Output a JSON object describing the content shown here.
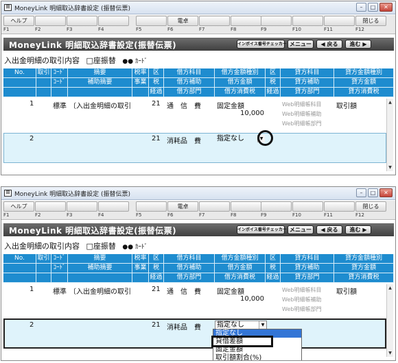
{
  "window": {
    "title": "MoneyLink 明細取込辞書設定 (振替伝票)",
    "buttons": {
      "minimize": "–",
      "maximize": "□",
      "close": "✕"
    }
  },
  "fkeys": [
    {
      "label": "ヘルプ",
      "num": "F1"
    },
    {
      "label": "",
      "num": "F2"
    },
    {
      "label": "",
      "num": "F3"
    },
    {
      "label": "",
      "num": "F4"
    },
    {
      "label": "",
      "num": "F5"
    },
    {
      "label": "電卓",
      "num": "F6"
    },
    {
      "label": "",
      "num": "F7"
    },
    {
      "label": "",
      "num": "F8"
    },
    {
      "label": "",
      "num": "F9"
    },
    {
      "label": "",
      "num": "F10"
    },
    {
      "label": "",
      "num": "F11"
    },
    {
      "label": "閉じる",
      "num": "F12"
    }
  ],
  "header": {
    "title": "MoneyLink 明細取込辞書設定(振替伝票)",
    "invoice_btn": "インボイス番号チェッカー",
    "menu_btn": "メニュー",
    "back_btn": "◀ 戻る",
    "next_btn": "進む ▶"
  },
  "subline": {
    "label": "入出金明細の取引内容",
    "check": "□座振替",
    "card": "●● ｶｰﾄﾞ"
  },
  "grid_headers": {
    "row1": [
      "No.",
      "取引",
      "ｺｰﾄﾞ",
      "摘要",
      "税率",
      "区",
      "借方科目",
      "借方金額種別",
      "区",
      "貸方科目",
      "貸方金額種別"
    ],
    "row2": [
      "",
      "",
      "ｺｰﾄﾞ",
      "補助摘要",
      "事業",
      "税",
      "借方補助",
      "借方金額",
      "税",
      "貸方補助",
      "貸方金額"
    ],
    "row3": [
      "",
      "",
      "",
      "",
      "",
      "経過",
      "借方部門",
      "借方消費税",
      "経過",
      "貸方部門",
      "貸方消費税"
    ]
  },
  "rows": [
    {
      "no": "1",
      "torihiki": "標準",
      "tekiyo": "〔入出金明細の取引",
      "zei": "21",
      "kari_kamoku": "通　信　費",
      "kari_shubetsu": "固定金額",
      "kari_kingaku": "10,000",
      "kashi_kamoku": "Web明細帳科目",
      "kashi_hojo": "Web明細帳補助",
      "kashi_bumon": "Web明細帳部門",
      "kashi_shubetsu": "取引額"
    },
    {
      "no": "2",
      "zei": "21",
      "kari_kamoku": "消耗品　費",
      "kari_shubetsu": "指定なし"
    }
  ],
  "dropdown_options": [
    "指定なし",
    "貸借差額",
    "固定金額",
    "取引額割合(%)"
  ]
}
